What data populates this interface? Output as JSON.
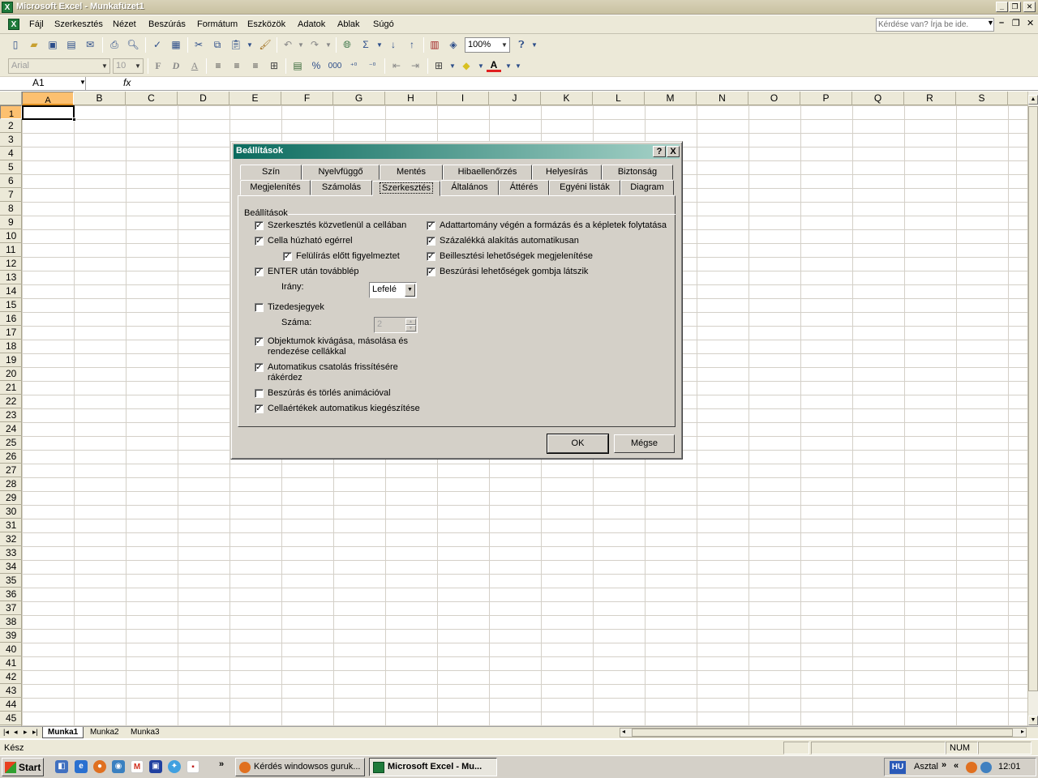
{
  "window": {
    "title": "Microsoft Excel - Munkafüzet1"
  },
  "menu": [
    "Fájl",
    "Szerkesztés",
    "Nézet",
    "Beszúrás",
    "Formátum",
    "Eszközök",
    "Adatok",
    "Ablak",
    "Súgó"
  ],
  "help_box": {
    "placeholder": "Kérdése van? Írja be ide."
  },
  "toolbar": {
    "zoom": "100%"
  },
  "format_toolbar": {
    "font": "Arial",
    "size": "10",
    "bold": "F",
    "italic": "D",
    "underline": "A",
    "percent": "%",
    "thousands": "000"
  },
  "formula_bar": {
    "cell": "A1",
    "fx": "fx"
  },
  "columns": [
    "A",
    "B",
    "C",
    "D",
    "E",
    "F",
    "G",
    "H",
    "I",
    "J",
    "K",
    "L",
    "M",
    "N",
    "O",
    "P",
    "Q",
    "R",
    "S"
  ],
  "rows": [
    "1",
    "2",
    "3",
    "4",
    "5",
    "6",
    "7",
    "8",
    "9",
    "10",
    "11",
    "12",
    "13",
    "14",
    "15",
    "16",
    "17",
    "18",
    "19",
    "20",
    "21",
    "22",
    "23",
    "24",
    "25",
    "26",
    "27",
    "28",
    "29",
    "30",
    "31",
    "32",
    "33",
    "34",
    "35",
    "36",
    "37",
    "38",
    "39",
    "40",
    "41",
    "42",
    "43",
    "44",
    "45"
  ],
  "sheets": [
    "Munka1",
    "Munka2",
    "Munka3"
  ],
  "status": {
    "text": "Kész",
    "num": "NUM"
  },
  "taskbar": {
    "start": "Start",
    "tasks": [
      "Kérdés windowsos guruk...",
      "Microsoft Excel - Mu..."
    ],
    "lang": "HU",
    "desktop": "Asztal",
    "time": "12:01"
  },
  "dialog": {
    "title": "Beállítások",
    "help": "?",
    "close": "X",
    "tabs_row1": [
      "Szín",
      "Nyelvfüggő",
      "Mentés",
      "Hibaellenőrzés",
      "Helyesírás",
      "Biztonság"
    ],
    "tabs_row2": [
      "Megjelenítés",
      "Számolás",
      "Szerkesztés",
      "Általános",
      "Áttérés",
      "Egyéni listák",
      "Diagram"
    ],
    "group": "Beállítások",
    "left": [
      {
        "label": "Szerkesztés közvetlenül a cellában",
        "checked": true
      },
      {
        "label": "Cella húzható egérrel",
        "checked": true
      },
      {
        "label": "Felülírás előtt figyelmeztet",
        "checked": true
      },
      {
        "label": "ENTER után továbblép",
        "checked": true
      },
      {
        "label": "Tizedesjegyek",
        "checked": false
      },
      {
        "label": "Objektumok kivágása, másolása és rendezése cellákkal",
        "checked": true
      },
      {
        "label": "Automatikus csatolás frissítésére rákérdez",
        "checked": true
      },
      {
        "label": "Beszúrás és törlés animációval",
        "checked": false
      },
      {
        "label": "Cellaértékek automatikus kiegészítése",
        "checked": true
      }
    ],
    "right": [
      {
        "label": "Adattartomány végén a formázás és a képletek folytatása",
        "checked": true
      },
      {
        "label": "Százalékká alakítás automatikusan",
        "checked": true
      },
      {
        "label": "Beillesztési lehetőségek megjelenítése",
        "checked": true
      },
      {
        "label": "Beszúrási lehetőségek gombja látszik",
        "checked": true
      }
    ],
    "direction_label": "Irány:",
    "direction_value": "Lefelé",
    "count_label": "Száma:",
    "count_value": "2",
    "ok": "OK",
    "cancel": "Mégse"
  }
}
